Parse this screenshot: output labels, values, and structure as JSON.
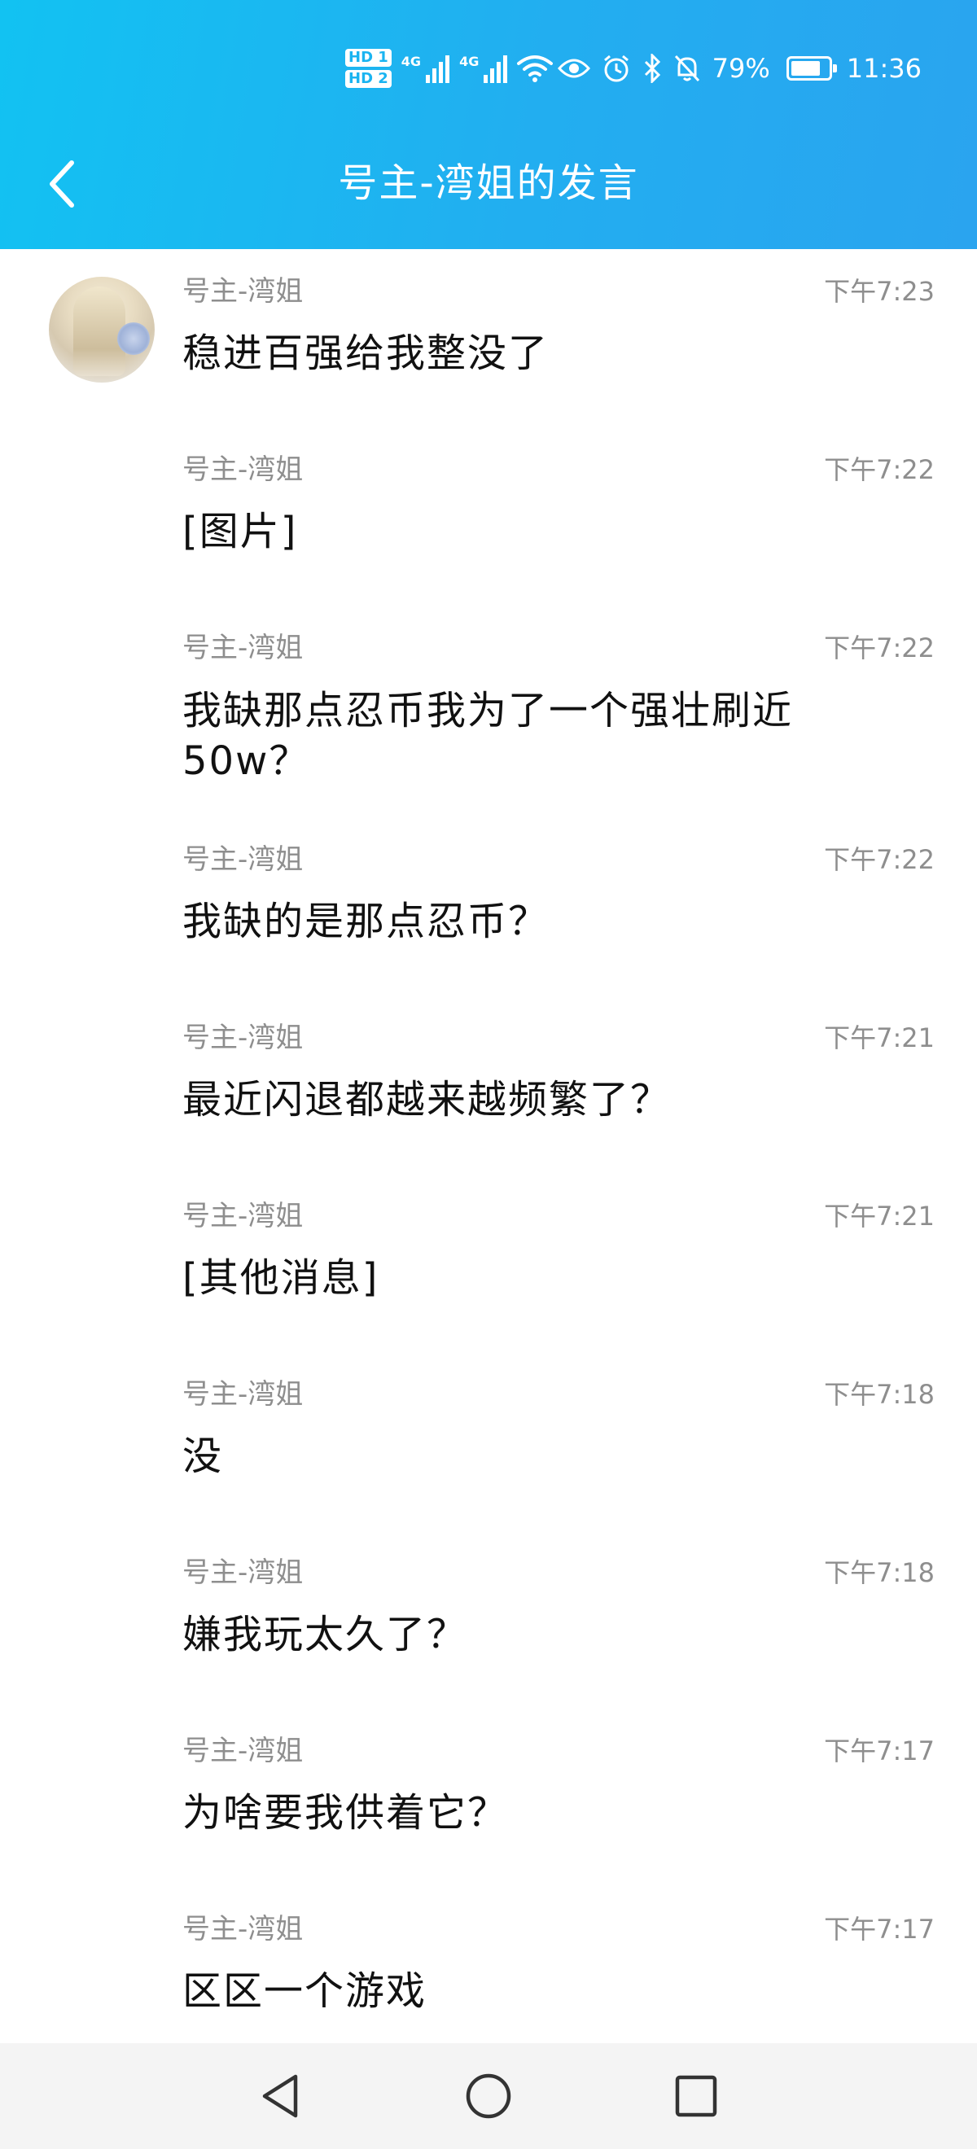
{
  "status_bar": {
    "hd1": "HD 1",
    "hd2": "HD 2",
    "sig1": "4G",
    "sig2": "4G",
    "battery_text": "79%",
    "battery_level": 0.79,
    "time": "11:36"
  },
  "header": {
    "title": "号主-湾姐的发言"
  },
  "messages": [
    {
      "sender": "号主-湾姐",
      "time": "下午7:23",
      "text": "稳进百强给我整没了",
      "show_avatar": true
    },
    {
      "sender": "号主-湾姐",
      "time": "下午7:22",
      "text": "[图片]"
    },
    {
      "sender": "号主-湾姐",
      "time": "下午7:22",
      "text": "我缺那点忍币我为了一个强壮刷近50w？"
    },
    {
      "sender": "号主-湾姐",
      "time": "下午7:22",
      "text": "我缺的是那点忍币？"
    },
    {
      "sender": "号主-湾姐",
      "time": "下午7:21",
      "text": "最近闪退都越来越频繁了？"
    },
    {
      "sender": "号主-湾姐",
      "time": "下午7:21",
      "text": "[其他消息]"
    },
    {
      "sender": "号主-湾姐",
      "time": "下午7:18",
      "text": "没"
    },
    {
      "sender": "号主-湾姐",
      "time": "下午7:18",
      "text": "嫌我玩太久了？"
    },
    {
      "sender": "号主-湾姐",
      "time": "下午7:17",
      "text": "为啥要我供着它？"
    },
    {
      "sender": "号主-湾姐",
      "time": "下午7:17",
      "text": "区区一个游戏"
    }
  ],
  "icons": {
    "back": "chevron-left-icon",
    "nav_back": "triangle-back-icon",
    "nav_home": "circle-home-icon",
    "nav_recents": "square-recents-icon"
  },
  "colors": {
    "header_gradient_start": "#12c2f2",
    "header_gradient_end": "#2aa4ef",
    "meta_text": "#8e8e8e",
    "body_text": "#111111"
  }
}
